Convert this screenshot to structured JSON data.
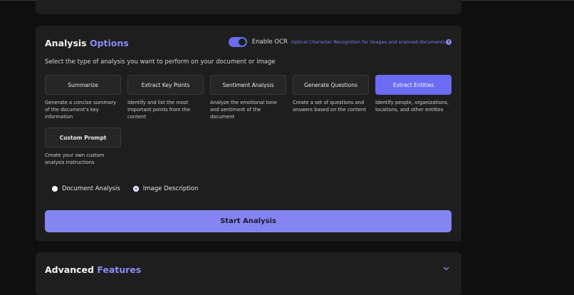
{
  "analysis": {
    "title_plain": "Analysis",
    "title_accent": "Options",
    "ocr_toggle_on": true,
    "ocr_label": "Enable OCR",
    "ocr_description": "Optical Character Recognition for images and scanned documents",
    "help_glyph": "?",
    "subtitle": "Select the type of analysis you want to perform on your document or image",
    "options": [
      {
        "label": "Summarize",
        "description": "Generate a concise summary of the document's key information",
        "active": false
      },
      {
        "label": "Extract Key Points",
        "description": "Identify and list the most important points from the content",
        "active": false
      },
      {
        "label": "Sentiment Analysis",
        "description": "Analyze the emotional tone and sentiment of the document",
        "active": false
      },
      {
        "label": "Generate Questions",
        "description": "Create a set of questions and answers based on the content",
        "active": false
      },
      {
        "label": "Extract Entities",
        "description": "Identify people, organizations, locations, and other entities",
        "active": true
      },
      {
        "label": "Custom Prompt",
        "description": "Create your own custom analysis instructions",
        "active": false
      }
    ],
    "modes": [
      {
        "label": "Document Analysis",
        "selected": false
      },
      {
        "label": "Image Description",
        "selected": true
      }
    ],
    "start_label": "Start Analysis"
  },
  "advanced": {
    "title_plain": "Advanced",
    "title_accent": "Features",
    "chevron_icon": "chevron-down-icon"
  },
  "colors": {
    "accent": "#6b6bf3",
    "accent_light": "#8b8bf5",
    "card_bg": "#1e1e1f",
    "page_bg": "#0f0f0f"
  }
}
